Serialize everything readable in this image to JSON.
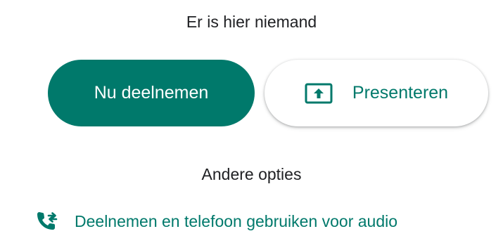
{
  "status": {
    "text": "Er is hier niemand"
  },
  "actions": {
    "join_label": "Nu deelnemen",
    "present_label": "Presenteren",
    "present_icon": "present-to-all-icon"
  },
  "other_options": {
    "title": "Andere opties",
    "phone_label": "Deelnemen en telefoon gebruiken voor audio",
    "phone_icon": "phone-forwarded-icon"
  },
  "colors": {
    "accent": "#00796b",
    "text": "#202124",
    "background": "#ffffff"
  }
}
